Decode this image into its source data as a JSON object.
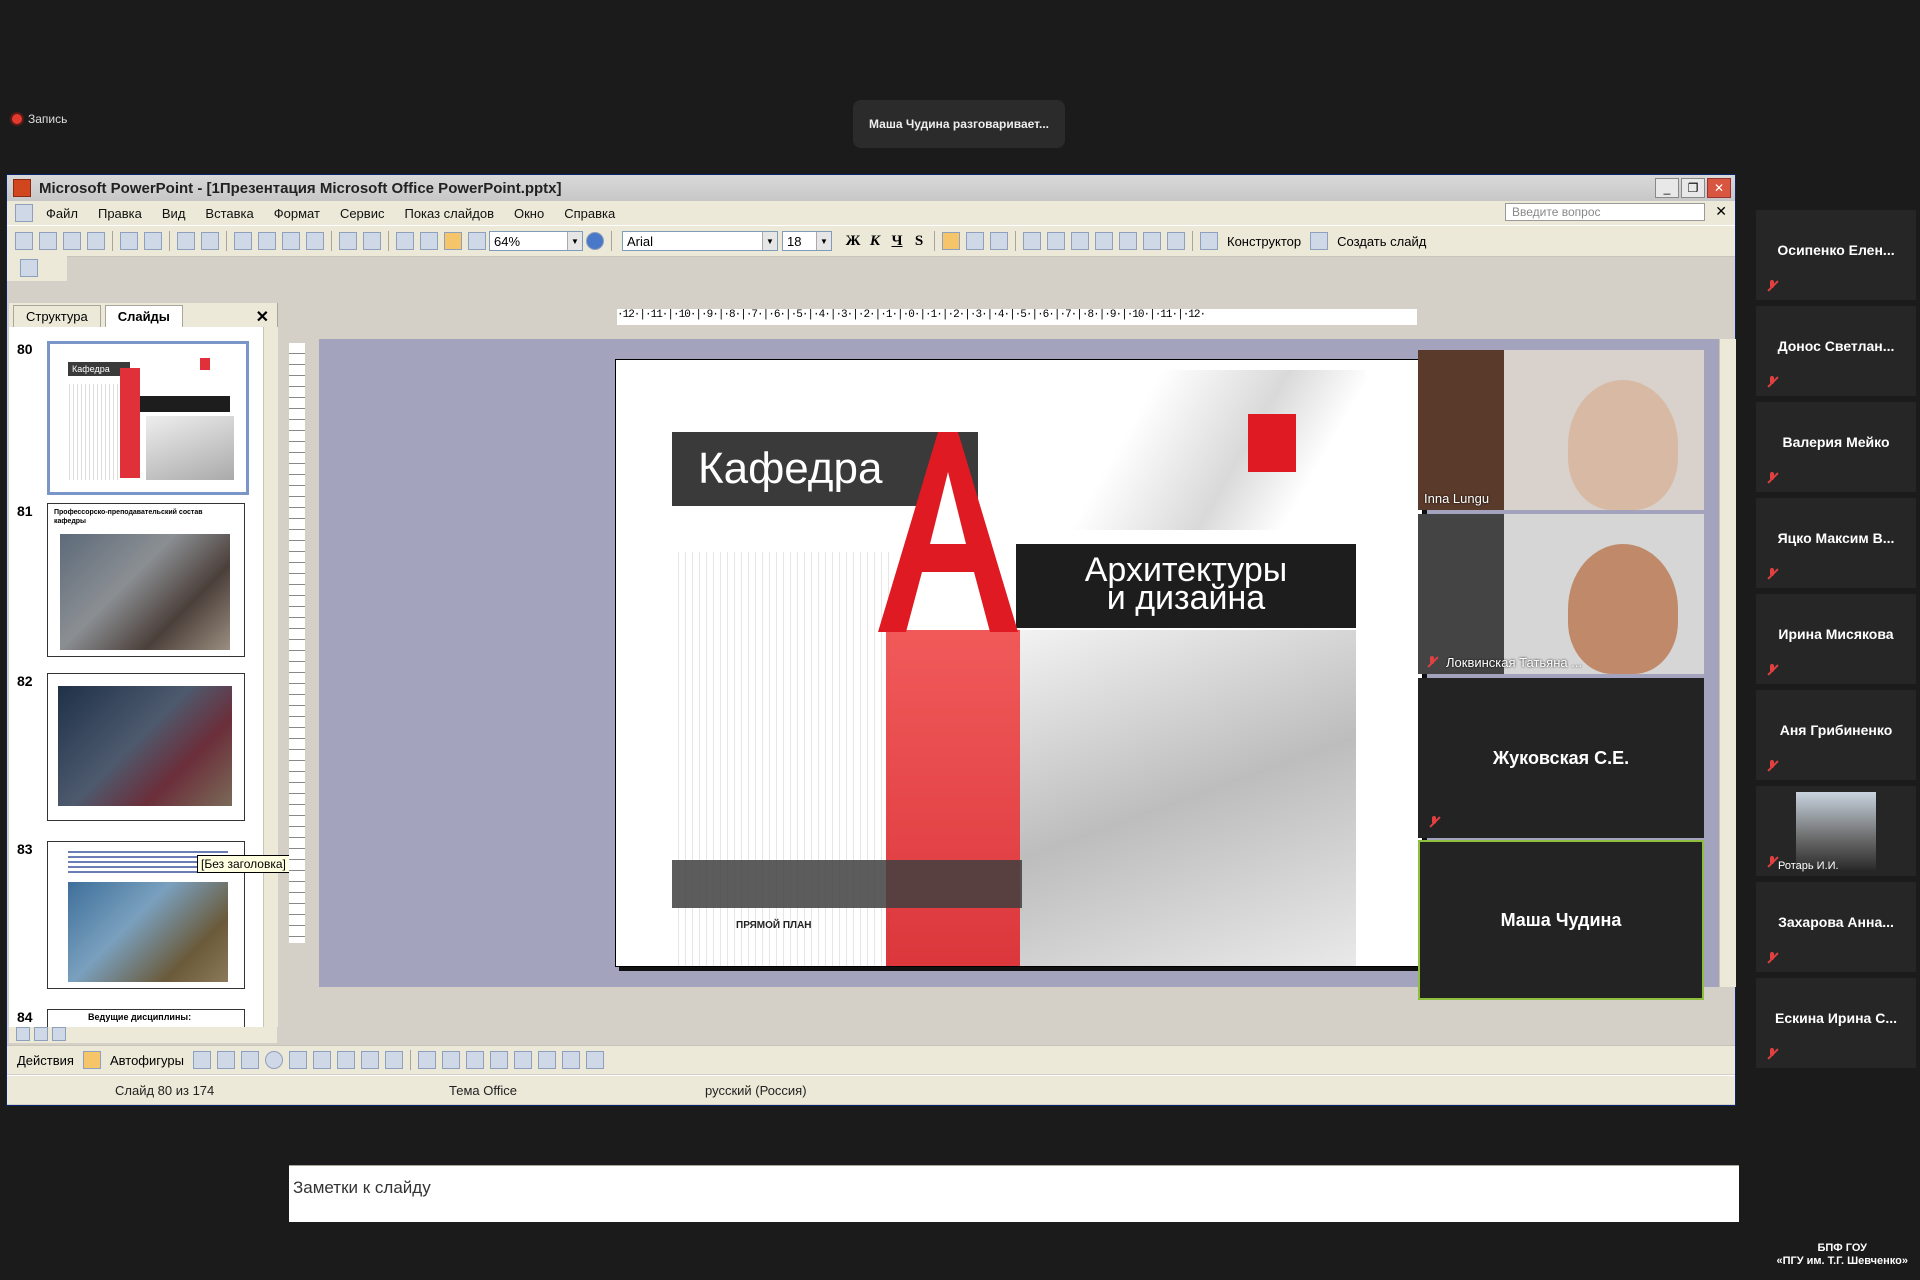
{
  "recording": {
    "label": "Запись"
  },
  "speaker_banner": "Маша Чудина разговаривает...",
  "window": {
    "title": "Microsoft PowerPoint - [1Презентация Microsoft Office PowerPoint.pptx]"
  },
  "menu": [
    "Файл",
    "Правка",
    "Вид",
    "Вставка",
    "Формат",
    "Сервис",
    "Показ слайдов",
    "Окно",
    "Справка"
  ],
  "ask_placeholder": "Введите вопрос",
  "toolbar": {
    "zoom": "64%",
    "font": "Arial",
    "font_size": "18",
    "bold": "Ж",
    "italic": "К",
    "underline": "Ч",
    "shadow": "S",
    "designer": "Конструктор",
    "new_slide": "Создать слайд"
  },
  "panel_tabs": {
    "outline": "Структура",
    "slides": "Слайды"
  },
  "thumbnails": [
    {
      "num": "80",
      "text": "Кафедра"
    },
    {
      "num": "81",
      "text": "Профессорско-преподавательский состав кафедры"
    },
    {
      "num": "82",
      "text": ""
    },
    {
      "num": "83",
      "text": ""
    },
    {
      "num": "84",
      "text": "Ведущие дисциплины:"
    }
  ],
  "tooltip": "[Без заголовка]",
  "ruler_text": "·12·|·11·|·10·|·9·|·8·|·7·|·6·|·5·|·4·|·3·|·2·|·1·|·0·|·1·|·2·|·3·|·4·|·5·|·6·|·7·|·8·|·9·|·10·|·11·|·12·",
  "slide": {
    "title": "Кафедра",
    "subtitle_line1": "Архитектуры",
    "subtitle_line2": "и дизайна",
    "plan_label": "ПРЯМОЙ ПЛАН"
  },
  "notes_placeholder": "Заметки к слайду",
  "drawbar": {
    "actions": "Действия",
    "autoshapes": "Автофигуры"
  },
  "status": {
    "slide": "Слайд 80 из 174",
    "theme": "Тема Office",
    "language": "русский (Россия)"
  },
  "video_tiles": [
    {
      "name": "Inna Lungu"
    },
    {
      "name": "Локвинская Татьяна ..."
    },
    {
      "name": "Жуковская С.Е."
    },
    {
      "name": "Маша Чудина"
    }
  ],
  "participants": [
    "Осипенко Елен...",
    "Донос Светлан...",
    "Валерия Мейко",
    "Яцко Максим В...",
    "Ирина Мисякова",
    "Аня Грибиненко",
    "Ротарь И.И.",
    "Захарова Анна...",
    "Ескина Ирина С..."
  ],
  "org": {
    "line1": "БПФ ГОУ",
    "line2": "«ПГУ им. Т.Г. Шевченко»"
  },
  "colors": {
    "accent_red": "#e01a22",
    "window_bg": "#ece9d8",
    "zoom_bg": "#1b1b1b"
  }
}
